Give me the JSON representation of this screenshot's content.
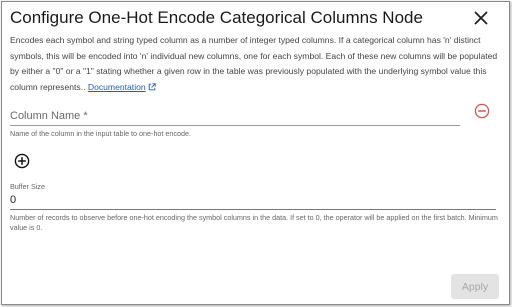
{
  "dialog": {
    "title": "Configure One-Hot Encode Categorical Columns Node",
    "description": "Encodes each symbol and string typed column as a number of integer typed columns. If a categorical column has 'n' distinct symbols, this will be encoded into 'n' individual new columns, one for each symbol. Each of these new columns will be populated by either a \"0\" or a \"1\" stating whether a given row in the table was previously populated with the underlying symbol value this column represents..",
    "documentation_link": "Documentation"
  },
  "column_name": {
    "placeholder": "Column Name *",
    "value": "",
    "helper": "Name of the column in the input table to one-hot encode."
  },
  "buffer_size": {
    "label": "Buffer Size",
    "value": "0",
    "helper": "Number of records to observe before one-hot encoding the symbol columns in the data. If set to 0, the operator will be applied on the first batch. Minimum value is 0."
  },
  "actions": {
    "apply_label": "Apply"
  },
  "colors": {
    "accent_remove": "#d9534f",
    "link": "#1f5fbf",
    "disabled_bg": "#e3e3e3",
    "disabled_text": "#a8a8a8"
  },
  "icons": {
    "close": "close-icon",
    "external_link": "external-link-icon",
    "remove": "remove-circle-icon",
    "add": "add-circle-icon"
  }
}
